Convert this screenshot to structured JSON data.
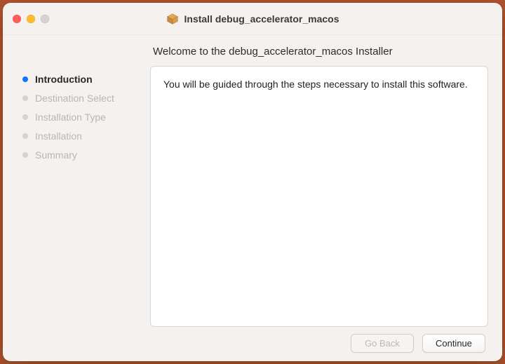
{
  "window": {
    "title": "Install debug_accelerator_macos",
    "icon": "package-icon"
  },
  "sidebar": {
    "steps": [
      {
        "label": "Introduction",
        "active": true
      },
      {
        "label": "Destination Select",
        "active": false
      },
      {
        "label": "Installation Type",
        "active": false
      },
      {
        "label": "Installation",
        "active": false
      },
      {
        "label": "Summary",
        "active": false
      }
    ]
  },
  "main": {
    "heading": "Welcome to the debug_accelerator_macos Installer",
    "body_text": "You will be guided through the steps necessary to install this software."
  },
  "footer": {
    "go_back_label": "Go Back",
    "continue_label": "Continue"
  }
}
